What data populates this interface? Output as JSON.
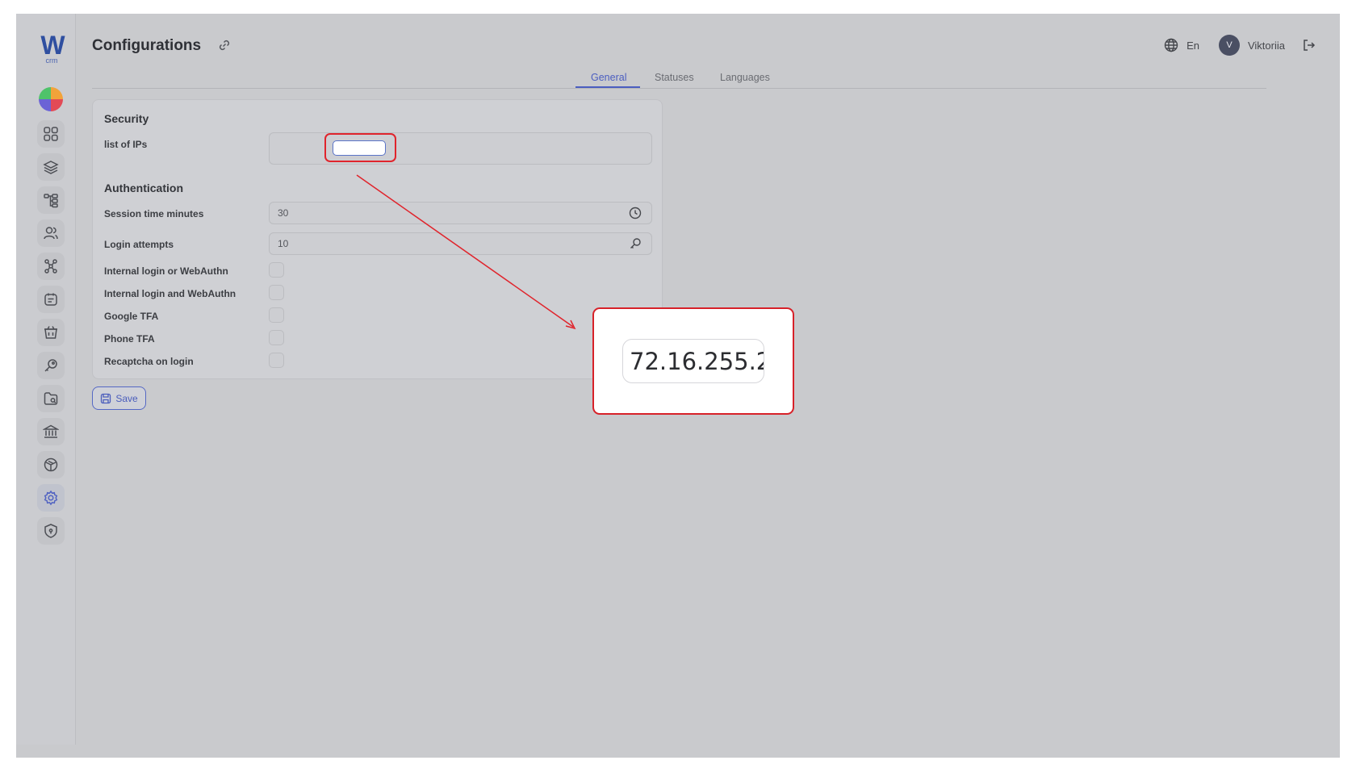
{
  "logo": {
    "mark": "W",
    "sub": "crm"
  },
  "header": {
    "title": "Configurations",
    "language": "En",
    "avatar_initial": "V",
    "user_name": "Viktoriia"
  },
  "tabs": [
    {
      "label": "General",
      "active": true
    },
    {
      "label": "Statuses",
      "active": false
    },
    {
      "label": "Languages",
      "active": false
    }
  ],
  "security": {
    "title": "Security",
    "ips_label": "list of IPs",
    "ips_value": ""
  },
  "authentication": {
    "title": "Authentication",
    "session_label": "Session time minutes",
    "session_value": "30",
    "attempts_label": "Login attempts",
    "attempts_value": "10",
    "options": [
      {
        "label": "Internal login or WebAuthn",
        "checked": false
      },
      {
        "label": "Internal login and WebAuthn",
        "checked": false
      },
      {
        "label": "Google TFA",
        "checked": false
      },
      {
        "label": "Phone TFA",
        "checked": false
      },
      {
        "label": "Recaptcha on login",
        "checked": false
      }
    ]
  },
  "save_label": "Save",
  "zoom": {
    "value": "72.16.255.2"
  },
  "colors": {
    "accent": "#4b5ec0",
    "annotation": "#d72129",
    "backdrop": "#c9cacd"
  },
  "sidebar_icons": [
    "dashboard-icon",
    "layers-icon",
    "hierarchy-icon",
    "users-icon",
    "network-icon",
    "tasks-icon",
    "basket-icon",
    "key-icon",
    "folder-icon",
    "bank-icon",
    "package-icon",
    "settings-icon",
    "shield-icon"
  ]
}
